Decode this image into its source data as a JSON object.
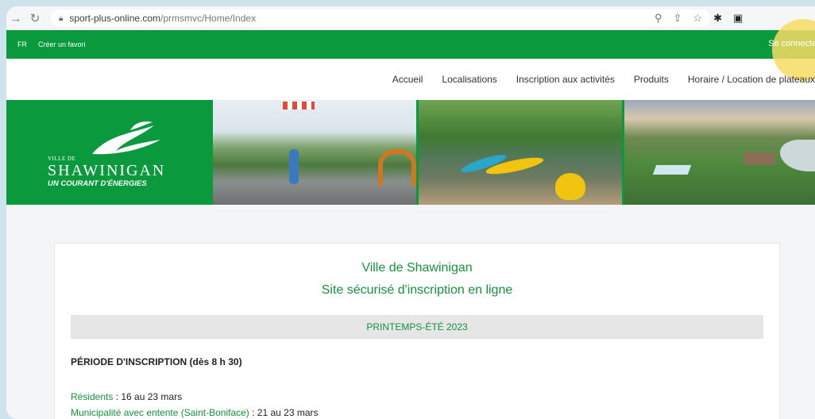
{
  "browser": {
    "url_host": "sport-plus-online.com",
    "url_path": "/prmsmvc/Home/Index"
  },
  "topbar": {
    "lang": "FR",
    "favorite": "Créer un favori",
    "login": "Se connecter"
  },
  "nav": {
    "items": [
      "Accueil",
      "Localisations",
      "Inscription aux activités",
      "Produits",
      "Horaire / Location de plateaux"
    ]
  },
  "logo": {
    "pre": "VILLE DE",
    "name": "SHAWINIGAN",
    "tagline": "UN COURANT D'ÉNERGIES"
  },
  "content": {
    "title": "Ville de Shawinigan",
    "subtitle": "Site sécurisé d'inscription en ligne",
    "season": "PRINTEMPS-ÉTÉ 2023",
    "period_title": "PÉRIODE D'INSCRIPTION (dès 8 h 30)",
    "residents_label": "Résidents",
    "residents_value": " : 16 au 23 mars",
    "muni_label": "Municipalité avec entente (Saint-Boniface)",
    "muni_value": " : 21 au 23 mars"
  },
  "colors": {
    "brand_green": "#0a9a3d",
    "highlight": "#f7dc64"
  }
}
